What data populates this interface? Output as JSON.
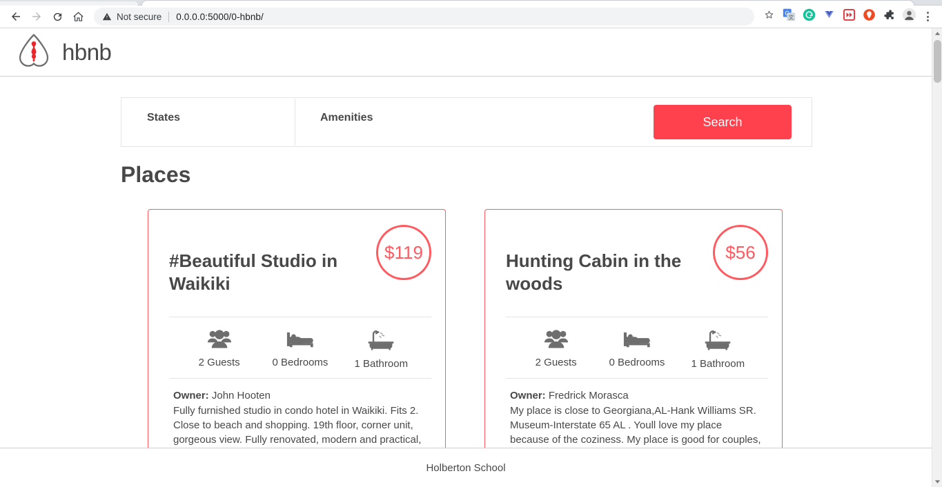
{
  "browser": {
    "nav": {
      "back_icon": "arrow-left-icon",
      "forward_icon": "arrow-right-icon",
      "reload_icon": "reload-icon",
      "home_icon": "home-icon"
    },
    "omnibox": {
      "security_icon": "not-secure-warning-icon",
      "security_label": "Not secure",
      "url": "0.0.0.0:5000/0-hbnb/"
    },
    "bookmark_icon": "star-outline-icon",
    "extensions": [
      {
        "name": "google-translate-icon",
        "title": "Google Translate"
      },
      {
        "name": "grammarly-icon",
        "title": "Grammarly"
      },
      {
        "name": "honey-icon",
        "title": "Honey"
      },
      {
        "name": "video-speed-controller-icon",
        "title": "Video Speed Controller"
      },
      {
        "name": "adblock-icon",
        "title": "AdBlock"
      },
      {
        "name": "extensions-puzzle-icon",
        "title": "Extensions"
      },
      {
        "name": "profile-avatar-icon",
        "title": "Profile"
      }
    ],
    "menu_icon": "three-dot-menu-icon"
  },
  "scrollbar": {
    "up_arrow_icon": "scroll-up-arrow-icon",
    "down_arrow_icon": "scroll-down-arrow-icon",
    "thumb_name": "scrollbar-thumb"
  },
  "header": {
    "logo_icon": "hbnb-belo-logo-icon",
    "logo_text": "hbnb"
  },
  "filters": {
    "states": {
      "label": "States",
      "icon": "states-filter"
    },
    "amenities": {
      "label": "Amenities",
      "icon": "amenities-filter"
    },
    "search_label": "Search",
    "search_color": "#FF414D"
  },
  "main": {
    "section_title": "Places",
    "places": [
      {
        "title": "#Beautiful Studio in Waikiki",
        "price": "$119",
        "guests": "2 Guests",
        "bedrooms": "0 Bedrooms",
        "bathrooms": "1 Bathroom",
        "owner_label": "Owner:",
        "owner_name": "John Hooten",
        "description": "Fully furnished studio in condo hotel in Waikiki. Fits 2. Close to beach and shopping. 19th floor, corner unit, gorgeous view. Fully renovated, modern and practical, has Internet, A/C. Amenities: W+D, pool, hot tub, BBQ area, places to eat."
      },
      {
        "title": "Hunting Cabin in the woods",
        "price": "$56",
        "guests": "2 Guests",
        "bedrooms": "0 Bedrooms",
        "bathrooms": "1 Bathroom",
        "owner_label": "Owner:",
        "owner_name": "Fredrick Morasca",
        "description": "My place is close to Georgiana,AL-Hank Williams SR. Museum-Interstate 65 AL . Youll love my place because of the coziness. My place is good for couples, solo adventurers, and families."
      }
    ],
    "icons": {
      "guests": "guests-group-icon",
      "bedrooms": "bed-icon",
      "bathrooms": "bath-shower-icon"
    },
    "card_border_color": "#FF5A5F",
    "price_color": "#FF5A5F"
  },
  "footer": {
    "text": "Holberton School"
  }
}
